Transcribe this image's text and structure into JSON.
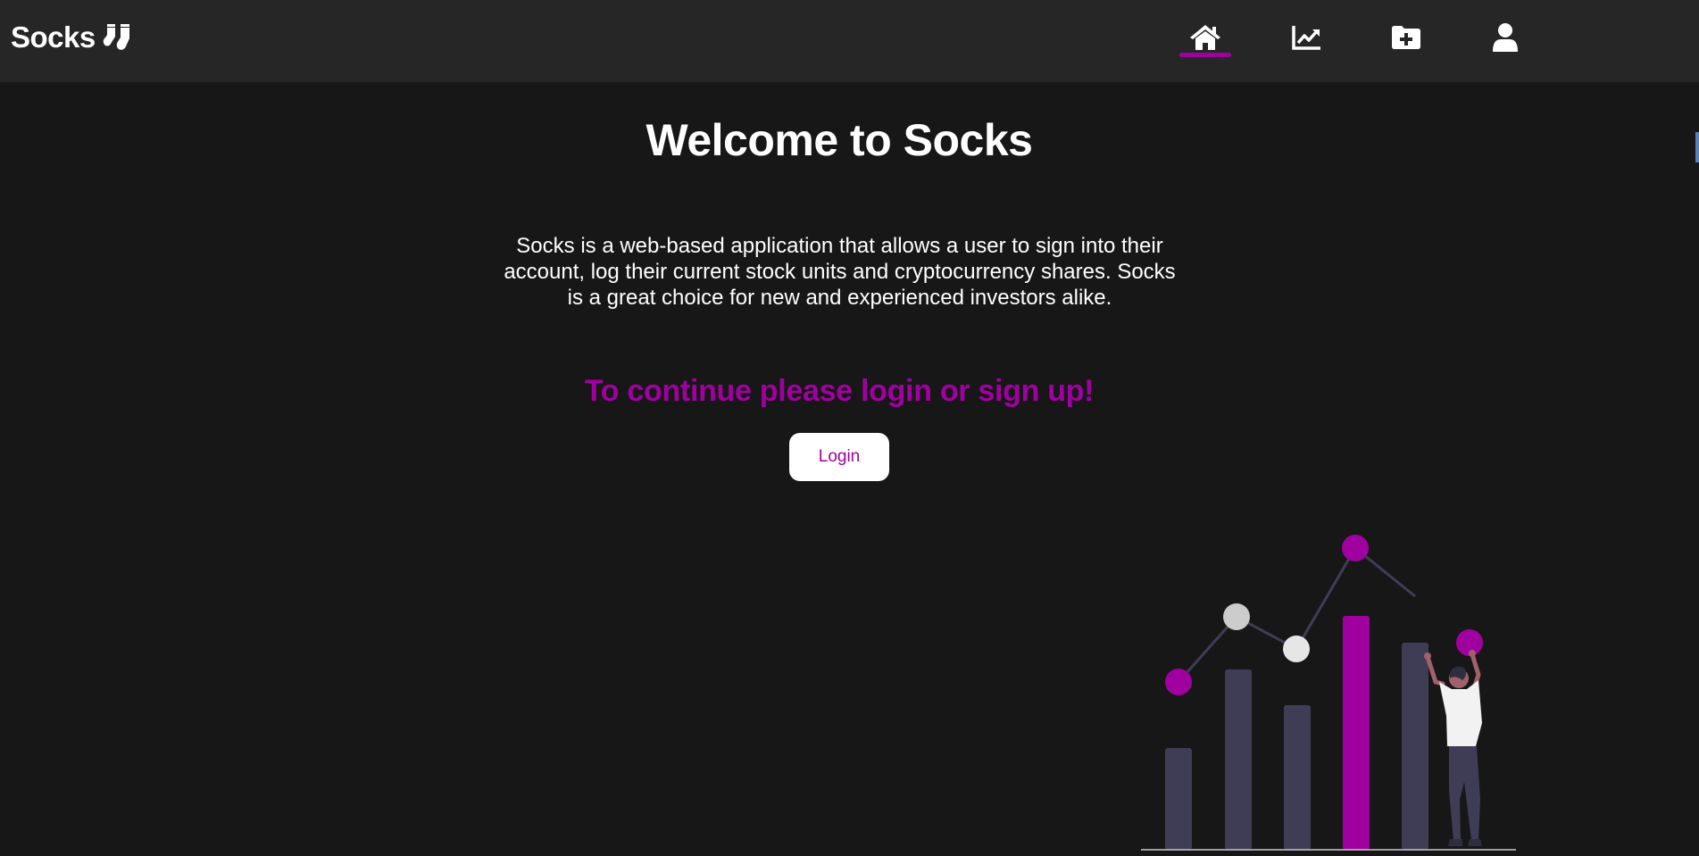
{
  "app": {
    "brand_name": "Socks",
    "brand_icon": "socks-icon"
  },
  "nav": {
    "items": [
      {
        "name": "home",
        "icon": "home-icon",
        "active": true
      },
      {
        "name": "portfolio",
        "icon": "chart-line-icon",
        "active": false
      },
      {
        "name": "add",
        "icon": "folder-plus-icon",
        "active": false
      },
      {
        "name": "profile",
        "icon": "user-icon",
        "active": false
      }
    ]
  },
  "main": {
    "title": "Welcome to Socks",
    "description": "Socks is a web-based application that allows a user to sign into their account, log their current stock units and cryptocurrency shares. Socks is a great choice for new and experienced investors alike.",
    "cta": "To continue please login or sign up!",
    "login_label": "Login"
  },
  "colors": {
    "accent": "#a000a0",
    "background": "#171717",
    "topbar": "#262626",
    "bar": "#3f3d56",
    "text": "#ffffff"
  }
}
